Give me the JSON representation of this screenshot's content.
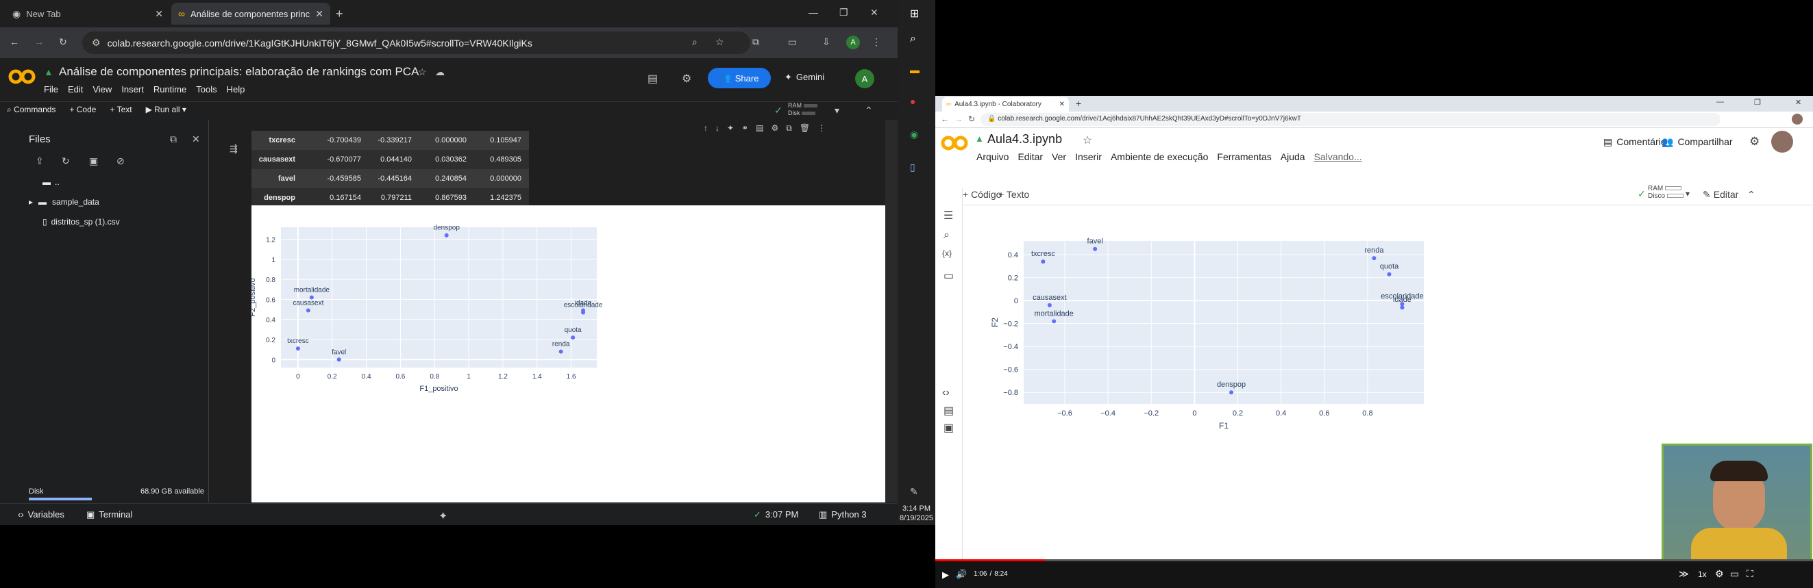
{
  "left": {
    "tabs": [
      {
        "title": "New Tab"
      },
      {
        "title": "Análise de componentes princip..."
      }
    ],
    "url": "colab.research.google.com/drive/1KagIGtKJHUnkiT6jY_8GMwf_QAk0I5w5#scrollTo=VRW40KIlgiKs",
    "notebook_title": "Análise de componentes  principais: elaboração de rankings com PCA",
    "menu": [
      "File",
      "Edit",
      "View",
      "Insert",
      "Runtime",
      "Tools",
      "Help"
    ],
    "share": "Share",
    "gemini": "Gemini",
    "avatar": "A",
    "toolbar": {
      "commands": "Commands",
      "code": "+ Code",
      "text": "+ Text",
      "run_all": "Run all",
      "ram": "RAM",
      "disk": "Disk"
    },
    "files_title": "Files",
    "tree": [
      "..",
      "sample_data",
      "distritos_sp (1).csv"
    ],
    "disk_label": "Disk",
    "disk_available": "68.90 GB available",
    "status": {
      "variables": "Variables",
      "terminal": "Terminal",
      "time": "3:07 PM",
      "runtime": "Python 3"
    },
    "table": [
      {
        "name": "txcresc",
        "c1": "-0.700439",
        "c2": "-0.339217",
        "c3": "0.000000",
        "c4": "0.105947"
      },
      {
        "name": "causasext",
        "c1": "-0.670077",
        "c2": "0.044140",
        "c3": "0.030362",
        "c4": "0.489305"
      },
      {
        "name": "favel",
        "c1": "-0.459585",
        "c2": "-0.445164",
        "c3": "0.240854",
        "c4": "0.000000"
      },
      {
        "name": "denspop",
        "c1": "0.167154",
        "c2": "0.797211",
        "c3": "0.867593",
        "c4": "1.242375"
      }
    ],
    "clock": {
      "time": "3:14 PM",
      "date": "8/19/2025"
    }
  },
  "chart_data": [
    {
      "type": "scatter",
      "xlabel": "F1_positivo",
      "ylabel": "F2_positivo",
      "xlim": [
        -0.1,
        1.75
      ],
      "ylim": [
        -0.08,
        1.32
      ],
      "xticks": [
        "0",
        "0.2",
        "0.4",
        "0.6",
        "0.8",
        "1",
        "1.2",
        "1.4",
        "1.6"
      ],
      "yticks": [
        "0",
        "0.2",
        "0.4",
        "0.6",
        "0.8",
        "1",
        "1.2"
      ],
      "points": [
        {
          "label": "denspop",
          "x": 0.87,
          "y": 1.24
        },
        {
          "label": "mortalidade",
          "x": 0.08,
          "y": 0.62
        },
        {
          "label": "causasext",
          "x": 0.06,
          "y": 0.49
        },
        {
          "label": "idade",
          "x": 1.67,
          "y": 0.49
        },
        {
          "label": "escolaridade",
          "x": 1.67,
          "y": 0.47
        },
        {
          "label": "quota",
          "x": 1.61,
          "y": 0.22
        },
        {
          "label": "renda",
          "x": 1.54,
          "y": 0.08
        },
        {
          "label": "txcresc",
          "x": 0.0,
          "y": 0.11
        },
        {
          "label": "favel",
          "x": 0.24,
          "y": 0.0
        }
      ]
    },
    {
      "type": "scatter",
      "xlabel": "F1",
      "ylabel": "F2",
      "xlim": [
        -0.79,
        1.06
      ],
      "ylim": [
        -0.9,
        0.52
      ],
      "xticks": [
        "−0.6",
        "−0.4",
        "−0.2",
        "0",
        "0.2",
        "0.4",
        "0.6",
        "0.8"
      ],
      "yticks": [
        "0.4",
        "0.2",
        "0",
        "−0.2",
        "−0.4",
        "−0.6",
        "−0.8"
      ],
      "points": [
        {
          "label": "favel",
          "x": -0.46,
          "y": 0.45
        },
        {
          "label": "txcresc",
          "x": -0.7,
          "y": 0.34
        },
        {
          "label": "renda",
          "x": 0.83,
          "y": 0.37
        },
        {
          "label": "quota",
          "x": 0.9,
          "y": 0.23
        },
        {
          "label": "causasext",
          "x": -0.67,
          "y": -0.04
        },
        {
          "label": "escolaridade",
          "x": 0.96,
          "y": -0.03
        },
        {
          "label": "idade",
          "x": 0.96,
          "y": -0.06
        },
        {
          "label": "mortalidade",
          "x": -0.65,
          "y": -0.18
        },
        {
          "label": "denspop",
          "x": 0.17,
          "y": -0.8
        }
      ]
    }
  ],
  "right": {
    "tab": "Aula4.3.ipynb - Colaboratory",
    "url": "colab.research.google.com/drive/1Acj6hdaix87UhhAE2skQht39UEAxd3yD#scrollTo=y0DJnV7j6kwT",
    "notebook_title": "Aula4.3.ipynb",
    "menu": [
      "Arquivo",
      "Editar",
      "Ver",
      "Inserir",
      "Ambiente de execução",
      "Ferramentas",
      "Ajuda"
    ],
    "saving": "Salvando...",
    "comment": "Comentário",
    "share": "Compartilhar",
    "code": "+ Código",
    "text": "+ Texto",
    "ram": "RAM",
    "disk": "Disco",
    "edit": "Editar",
    "player": {
      "time": "1:06",
      "sep": "/",
      "duration": "8:24",
      "speed": "1x",
      "progress": 0.125
    }
  }
}
